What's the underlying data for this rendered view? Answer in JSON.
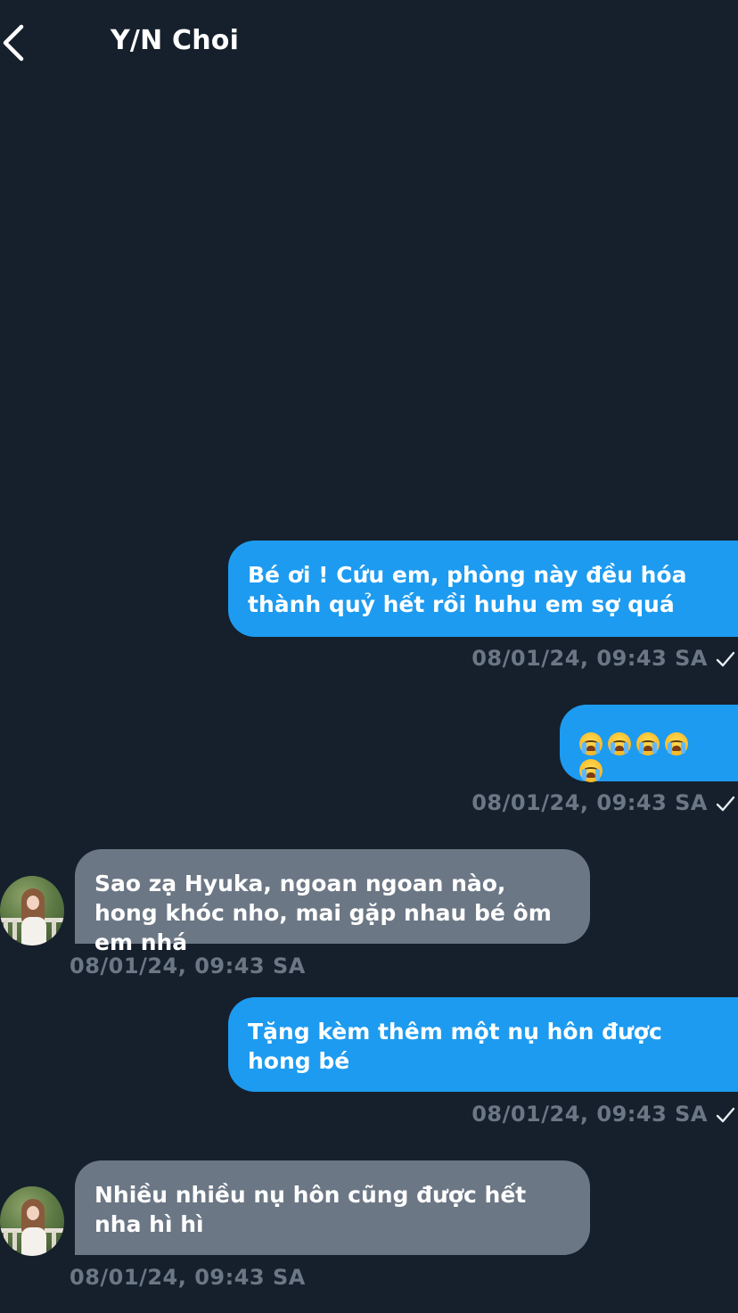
{
  "header": {
    "back_icon": "chevron-left-icon",
    "title": "Y/N Choi"
  },
  "messages": [
    {
      "direction": "outgoing",
      "text": "Bé ơi ! Cứu em, phòng này đều hóa thành quỷ hết rồi huhu em sợ quá",
      "timestamp": "08/01/24, 09:43 SA",
      "status_icon": "checkmark-icon"
    },
    {
      "direction": "outgoing",
      "text": "😭😭😭😭😭",
      "timestamp": "08/01/24, 09:43 SA",
      "status_icon": "checkmark-icon"
    },
    {
      "direction": "incoming",
      "text": "Sao zạ Hyuka, ngoan ngoan nào, hong khóc nho, mai gặp nhau bé ôm em nhá",
      "timestamp": "08/01/24, 09:43 SA"
    },
    {
      "direction": "outgoing",
      "text": "Tặng kèm thêm một nụ hôn được hong bé",
      "timestamp": "08/01/24, 09:43 SA",
      "status_icon": "checkmark-icon"
    },
    {
      "direction": "incoming",
      "text": "Nhiều nhiều nụ hôn cũng được hết nha hì hì",
      "timestamp": "08/01/24, 09:43 SA"
    }
  ],
  "colors": {
    "background": "#16202c",
    "outgoing_bubble": "#1d9bf0",
    "incoming_bubble": "#6c7785",
    "timestamp": "#6b7785"
  }
}
